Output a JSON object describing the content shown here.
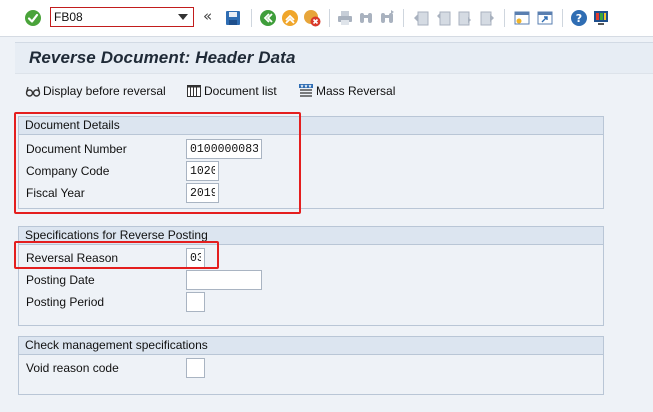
{
  "toolbar": {
    "command_value": "FB08",
    "icons": [
      "enter-icon",
      "save-icon",
      "back-icon",
      "exit-icon",
      "cancel-icon",
      "print-icon",
      "find-icon",
      "find-next-icon",
      "first-page-icon",
      "previous-page-icon",
      "next-page-icon",
      "last-page-icon",
      "create-session-icon",
      "shortcut-icon",
      "help-icon",
      "customize-layout-icon"
    ],
    "collapse_glyph": "«"
  },
  "title": "Reverse Document: Header Data",
  "app_toolbar": {
    "display_before_reversal": "Display before reversal",
    "document_list": "Document list",
    "mass_reversal": "Mass Reversal"
  },
  "document_details": {
    "title": "Document Details",
    "document_number_label": "Document Number",
    "document_number_value": "0100000083",
    "company_code_label": "Company Code",
    "company_code_value": "1020",
    "fiscal_year_label": "Fiscal Year",
    "fiscal_year_value": "2019"
  },
  "reverse_posting": {
    "title": "Specifications for Reverse Posting",
    "reversal_reason_label": "Reversal Reason",
    "reversal_reason_value": "03",
    "posting_date_label": "Posting Date",
    "posting_date_value": "",
    "posting_period_label": "Posting Period",
    "posting_period_value": ""
  },
  "check_management": {
    "title": "Check management specifications",
    "void_reason_label": "Void reason code",
    "void_reason_value": ""
  },
  "colors": {
    "highlight": "#e41e1e",
    "enter_green": "#4aa33a",
    "group_header": "#dce5f0",
    "background": "#eef2f7"
  }
}
